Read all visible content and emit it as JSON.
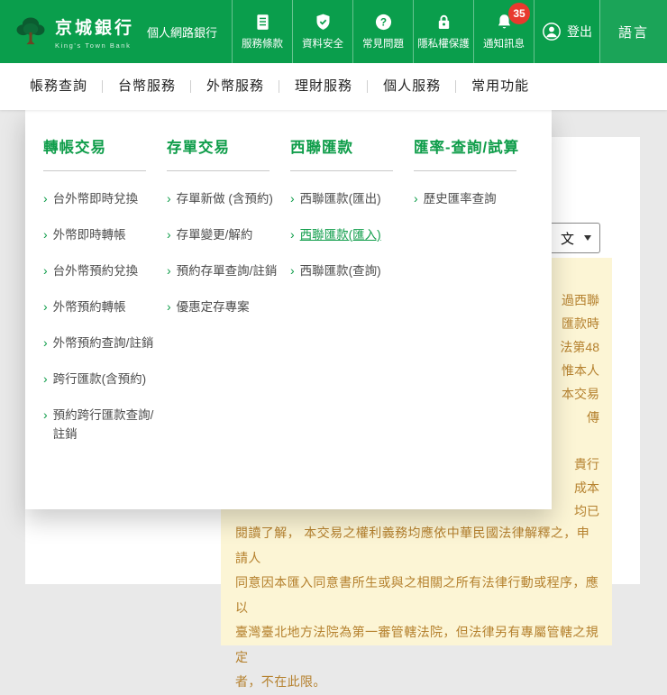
{
  "header": {
    "bank_name": "京城銀行",
    "bank_name_en": "King's Town Bank",
    "product": "個人網路銀行",
    "quick_links": [
      {
        "label": "服務條款",
        "icon": "document-icon"
      },
      {
        "label": "資料安全",
        "icon": "shield-icon"
      },
      {
        "label": "常見問題",
        "icon": "question-icon"
      },
      {
        "label": "隱私權保護",
        "icon": "lock-icon"
      },
      {
        "label": "通知訊息",
        "icon": "bell-icon",
        "badge": "35"
      }
    ],
    "logout_label": "登出",
    "language_label": "語言"
  },
  "nav": {
    "items": [
      "帳務查詢",
      "台幣服務",
      "外幣服務",
      "理財服務",
      "個人服務",
      "常用功能"
    ]
  },
  "mega_menu": {
    "columns": [
      {
        "title": "轉帳交易",
        "items": [
          "台外幣即時兌換",
          "外幣即時轉帳",
          "台外幣預約兌換",
          "外幣預約轉帳",
          "外幣預約查詢/註銷",
          "跨行匯款(含預約)",
          "預約跨行匯款查詢/註銷"
        ]
      },
      {
        "title": "存單交易",
        "items": [
          "存單新做 (含預約)",
          "存單變更/解約",
          "預約存單查詢/註銷",
          "優惠定存專案"
        ]
      },
      {
        "title": "西聯匯款",
        "items": [
          "西聯匯款(匯出)",
          "西聯匯款(匯入)",
          "西聯匯款(查詢)"
        ],
        "active_item": "西聯匯款(匯入)"
      },
      {
        "title": "匯率-查詢/試算",
        "items": [
          "歷史匯率查詢"
        ]
      }
    ]
  },
  "content": {
    "language_select_value": "文",
    "notice_fragments": [
      "過西聯",
      "匯款時",
      "法第48",
      "惟本人",
      "本交易",
      "傳",
      "",
      "貴行",
      "成本",
      "均已"
    ],
    "notice_lines": [
      "閱讀了解， 本交易之權利義務均應依中華民國法律解釋之，申請人",
      "同意因本匯入同意書所生或與之相關之所有法律行動或程序，應以",
      "臺灣臺北地方法院為第一審管轄法院，但法律另有專屬管轄之規定",
      "者，不在此限。"
    ]
  },
  "colors": {
    "brand_green": "#0a9e4c",
    "logo_dark_green": "#0b5c30",
    "menu_green": "#0f9d4a",
    "badge_red": "#e8392e",
    "notice_bg": "#fcf5d5",
    "notice_text": "#b5812e"
  }
}
